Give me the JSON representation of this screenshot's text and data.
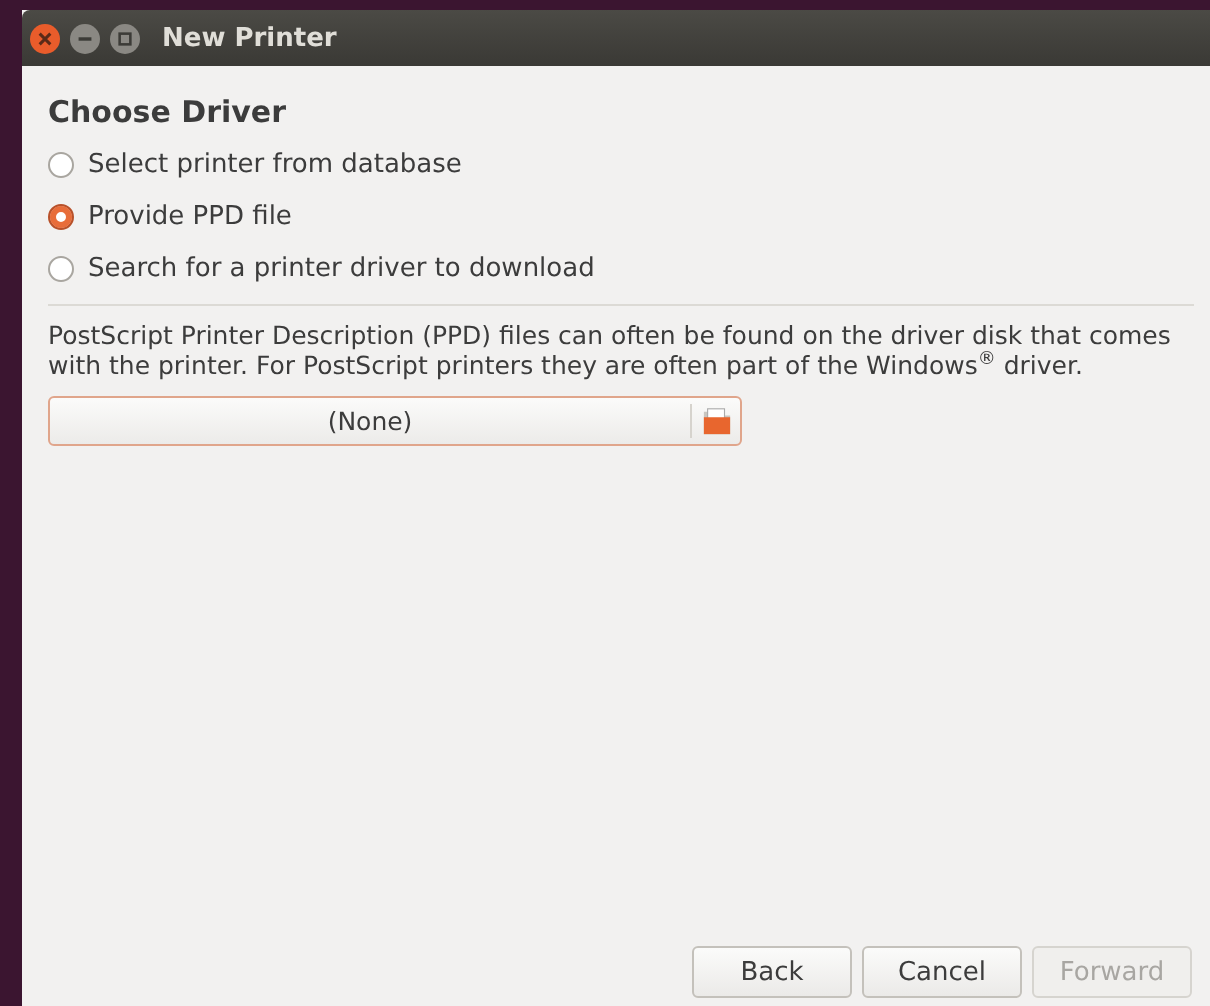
{
  "window": {
    "title": "New Printer"
  },
  "heading": "Choose Driver",
  "options": [
    {
      "label": "Select printer from database",
      "selected": false
    },
    {
      "label": "Provide PPD file",
      "selected": true
    },
    {
      "label": "Search for a printer driver to download",
      "selected": false
    }
  ],
  "description": "PostScript Printer Description (PPD) files can often be found on the driver disk that comes with the printer. For PostScript printers they are often part of the Windows$^{®}$ driver.",
  "file_chooser": {
    "value": "(None)"
  },
  "buttons": [
    {
      "label": "Back",
      "disabled": false
    },
    {
      "label": "Cancel",
      "disabled": false
    },
    {
      "label": "Forward",
      "disabled": true
    }
  ]
}
